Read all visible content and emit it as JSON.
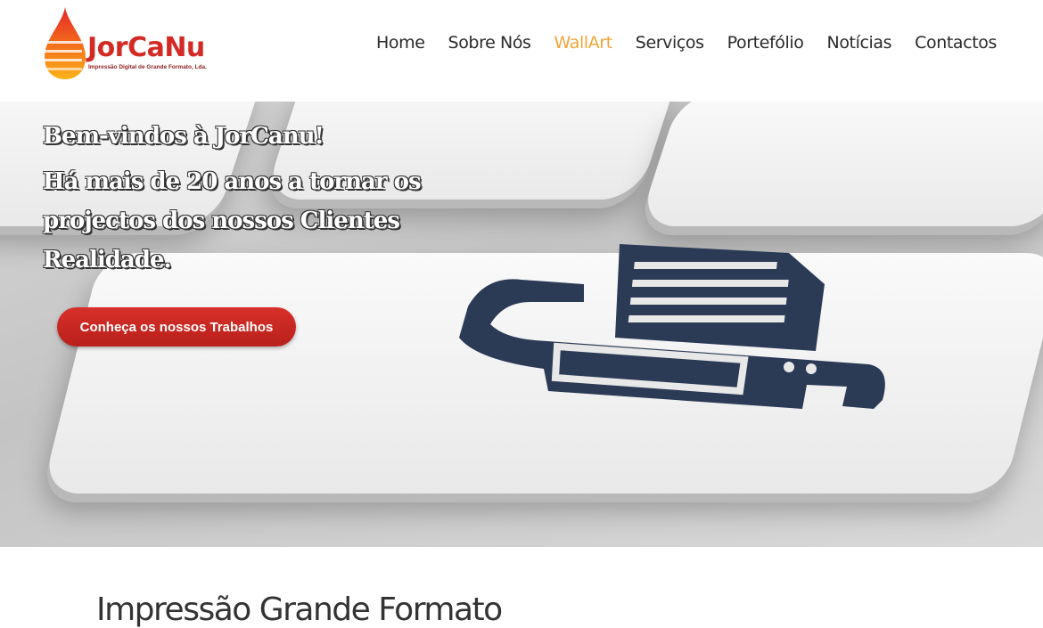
{
  "brand": {
    "name": "JorCaNu",
    "tagline": "Impressão Digital de Grande Formato, Lda.",
    "colors": {
      "accent": "#f0a43a",
      "primary": "#d42a26"
    }
  },
  "nav": {
    "items": [
      {
        "label": "Home",
        "active": false
      },
      {
        "label": "Sobre Nós",
        "active": false
      },
      {
        "label": "WallArt",
        "active": true
      },
      {
        "label": "Serviços",
        "active": false
      },
      {
        "label": "Portefólio",
        "active": false
      },
      {
        "label": "Notícias",
        "active": false
      },
      {
        "label": "Contactos",
        "active": false
      }
    ]
  },
  "hero": {
    "welcome": "Bem-vindos à JorCanu!",
    "tagline": "Há mais de 20 anos a tornar os projectos dos nossos Clientes Realidade.",
    "cta_label": "Conheça os nossos Trabalhos",
    "icon": "printer-icon"
  },
  "section": {
    "title": "Impressão Grande Formato"
  }
}
